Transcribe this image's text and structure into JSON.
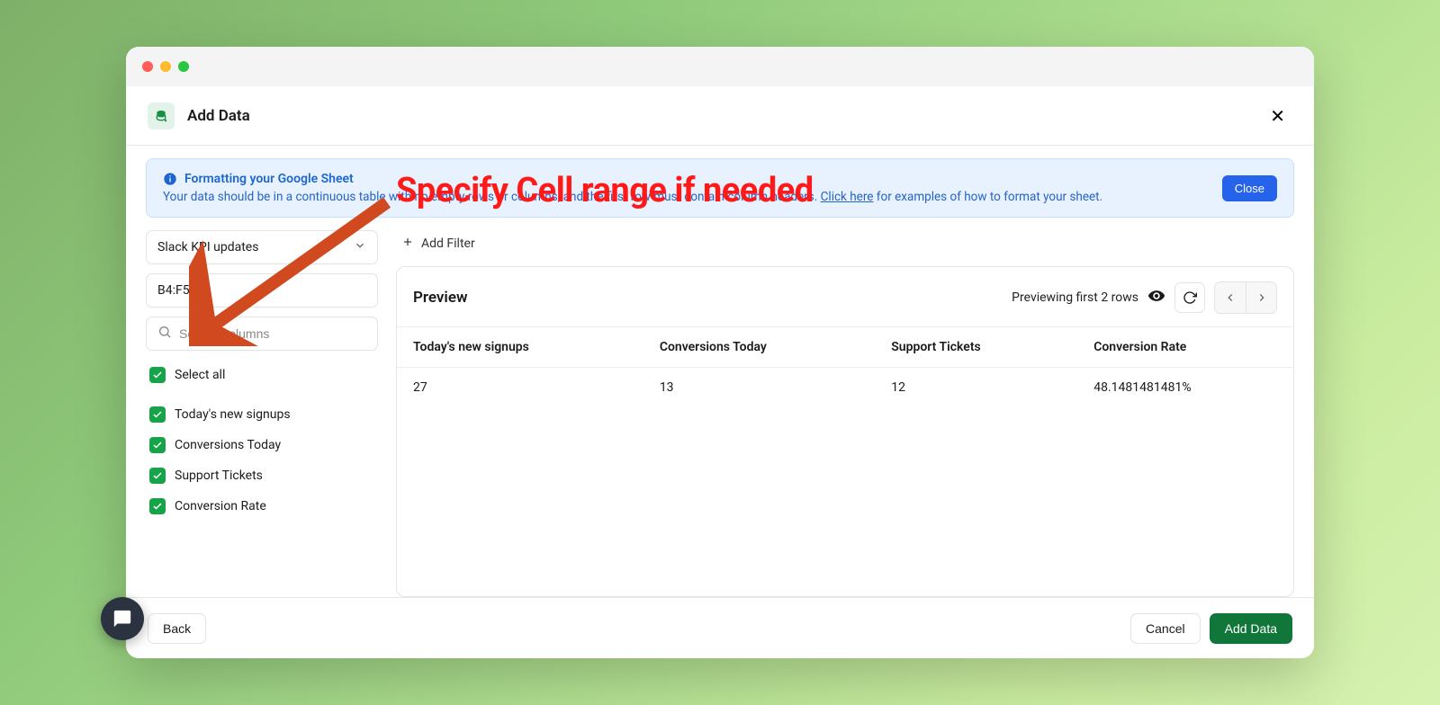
{
  "window": {
    "title": "Add Data",
    "close_icon": "✕"
  },
  "banner": {
    "title": "Formatting your Google Sheet",
    "body_before_link": "Your data should be in a continuous table with no empty rows or columns, and the first row must contain column headers. ",
    "link_text": "Click here",
    "body_after_link": " for examples of how to format your sheet.",
    "close_label": "Close"
  },
  "sidebar": {
    "sheet_select_value": "Slack KPI updates",
    "range_value": "B4:F5",
    "search_placeholder": "Search columns",
    "select_all_label": "Select all",
    "columns": [
      {
        "label": "Today's new signups"
      },
      {
        "label": "Conversions Today"
      },
      {
        "label": "Support Tickets"
      },
      {
        "label": "Conversion Rate"
      }
    ]
  },
  "content": {
    "add_filter_label": "Add Filter",
    "preview_title": "Preview",
    "preview_status": "Previewing first 2 rows",
    "table": {
      "headers": [
        "Today's new signups",
        "Conversions Today",
        "Support Tickets",
        "Conversion Rate"
      ],
      "row": [
        "27",
        "13",
        "12",
        "48.1481481481%"
      ]
    }
  },
  "footer": {
    "back_label": "Back",
    "cancel_label": "Cancel",
    "submit_label": "Add Data"
  },
  "annotation": {
    "text": "Specify Cell range if needed"
  }
}
